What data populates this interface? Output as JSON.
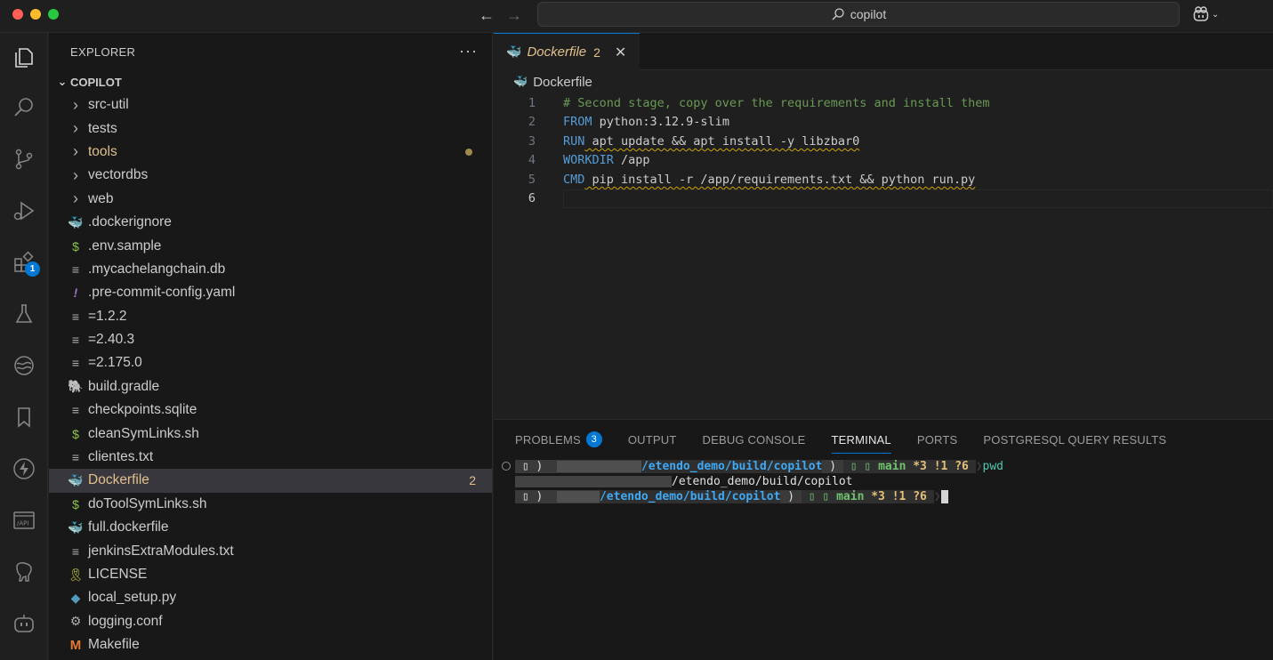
{
  "titlebar": {
    "search_text": "copilot"
  },
  "activity": {
    "extensions_badge": "1"
  },
  "sidebar": {
    "title": "EXPLORER",
    "more": "···",
    "section": "COPILOT",
    "items": [
      {
        "label": "src-util",
        "type": "folder"
      },
      {
        "label": "tests",
        "type": "folder"
      },
      {
        "label": "tools",
        "type": "folder"
      },
      {
        "label": "vectordbs",
        "type": "folder"
      },
      {
        "label": "web",
        "type": "folder"
      },
      {
        "label": ".dockerignore",
        "type": "docker"
      },
      {
        "label": ".env.sample",
        "type": "shell"
      },
      {
        "label": ".mycachelangchain.db",
        "type": "text"
      },
      {
        "label": ".pre-commit-config.yaml",
        "type": "yaml"
      },
      {
        "label": "=1.2.2",
        "type": "text"
      },
      {
        "label": "=2.40.3",
        "type": "text"
      },
      {
        "label": "=2.175.0",
        "type": "text"
      },
      {
        "label": "build.gradle",
        "type": "gradle"
      },
      {
        "label": "checkpoints.sqlite",
        "type": "text"
      },
      {
        "label": "cleanSymLinks.sh",
        "type": "shell"
      },
      {
        "label": "clientes.txt",
        "type": "text"
      },
      {
        "label": "Dockerfile",
        "type": "docker",
        "count": "2"
      },
      {
        "label": "doToolSymLinks.sh",
        "type": "shell"
      },
      {
        "label": "full.dockerfile",
        "type": "docker"
      },
      {
        "label": "jenkinsExtraModules.txt",
        "type": "text"
      },
      {
        "label": "LICENSE",
        "type": "license"
      },
      {
        "label": "local_setup.py",
        "type": "python"
      },
      {
        "label": "logging.conf",
        "type": "gear"
      },
      {
        "label": "Makefile",
        "type": "make"
      }
    ]
  },
  "editor": {
    "tab_name": "Dockerfile",
    "tab_count": "2",
    "breadcrumb": "Dockerfile",
    "lines": [
      {
        "n": "1",
        "kw": "",
        "text": "# Second stage, copy over the requirements and install them"
      },
      {
        "n": "2",
        "kw": "FROM",
        "text": " python:3.12.9-slim"
      },
      {
        "n": "3",
        "kw": "RUN",
        "text": " apt update && apt install -y libzbar0"
      },
      {
        "n": "4",
        "kw": "WORKDIR",
        "text": " /app"
      },
      {
        "n": "5",
        "kw": "CMD",
        "text": " pip install -r /app/requirements.txt && python run.py"
      },
      {
        "n": "6",
        "kw": "",
        "text": ""
      }
    ]
  },
  "panel": {
    "tabs": {
      "problems": "PROBLEMS",
      "problems_count": "3",
      "output": "OUTPUT",
      "debug": "DEBUG CONSOLE",
      "terminal": "TERMINAL",
      "ports": "PORTS",
      "pg": "POSTGRESQL QUERY RESULTS"
    },
    "terminal": {
      "path1": "/etendo_demo/build/copilot",
      "git_branch": "main",
      "git_status": "*3 !1 ?6",
      "cmd": "pwd",
      "output_path": "/etendo_demo/build/copilot",
      "path2": "/etendo_demo/build/copilot"
    }
  }
}
